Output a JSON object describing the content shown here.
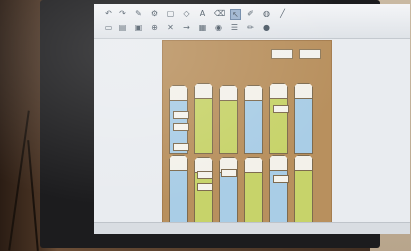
{
  "photo": {
    "subject": "interactive-whiteboard-software",
    "board_color": "#b8905e",
    "column_colors": [
      "#a9cde6",
      "#c7d36a"
    ]
  }
}
